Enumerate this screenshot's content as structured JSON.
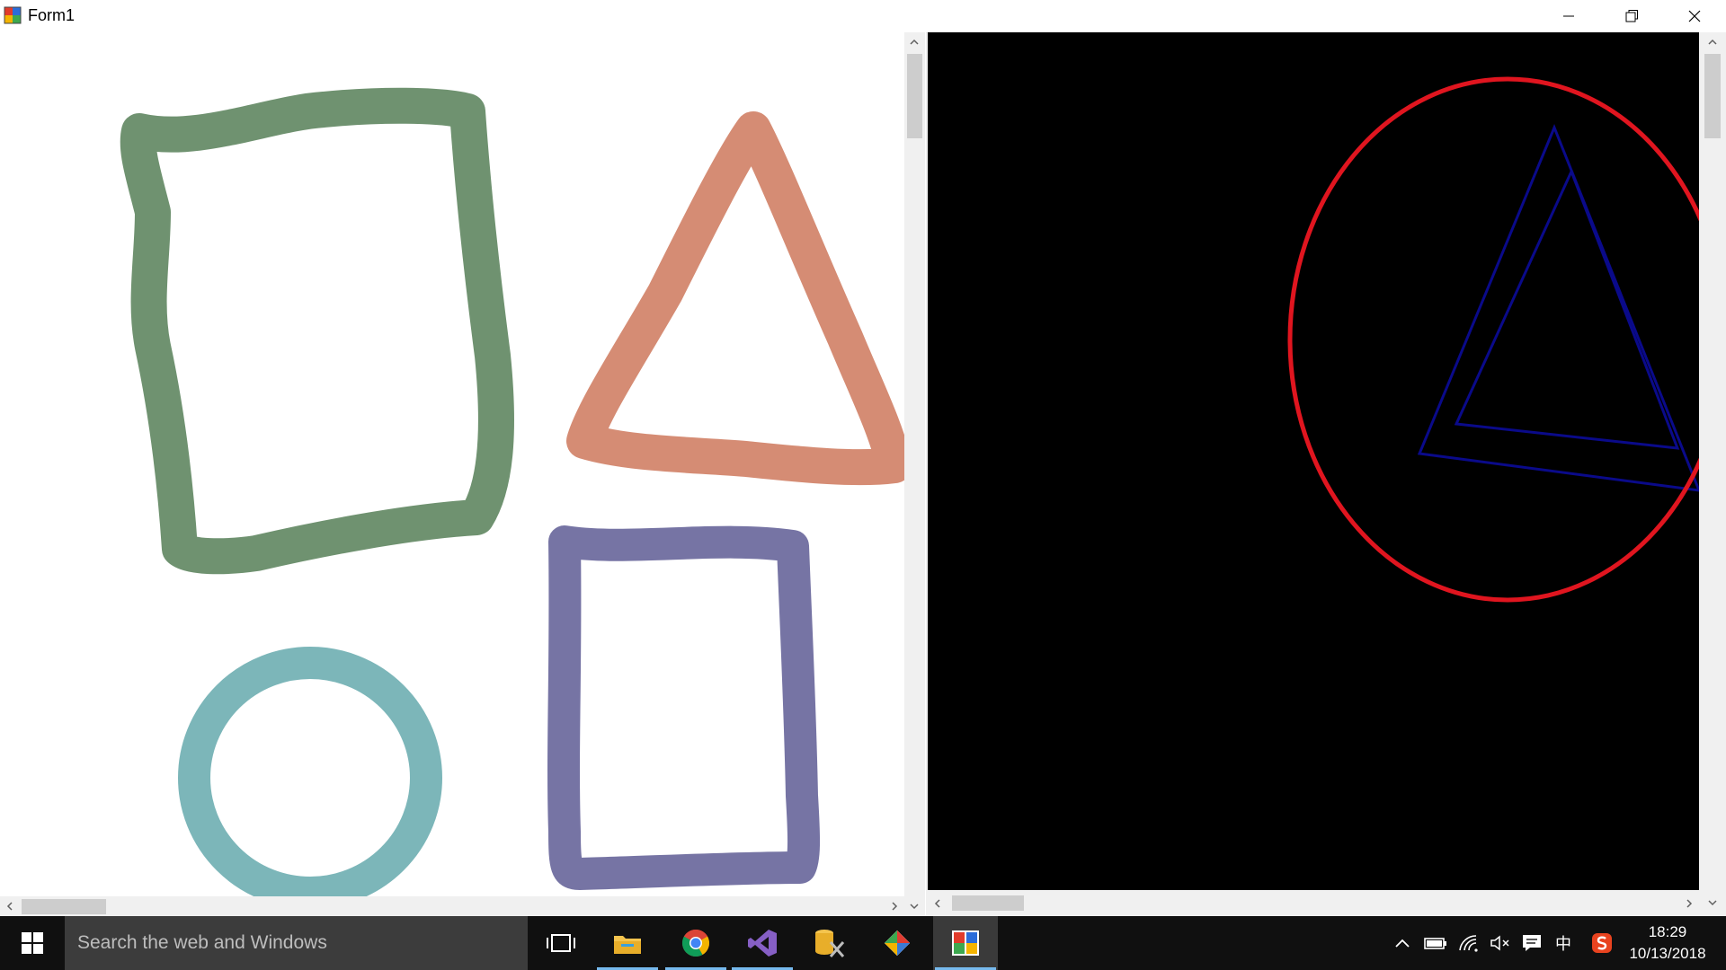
{
  "window": {
    "title": "Form1",
    "controls": {
      "minimize_icon": "minimize-icon",
      "restore_icon": "restore-icon",
      "close_icon": "close-icon"
    }
  },
  "left_canvas": {
    "background": "#ffffff",
    "shapes": [
      {
        "kind": "hand-drawn rectangle",
        "color": "#6f9270"
      },
      {
        "kind": "hand-drawn triangle",
        "color": "#d58c74"
      },
      {
        "kind": "hand-drawn circle",
        "color": "#7cb6b9"
      },
      {
        "kind": "hand-drawn rectangle",
        "color": "#7674a4"
      }
    ]
  },
  "right_canvas": {
    "background": "#000000",
    "shapes": [
      {
        "kind": "triangle outline",
        "color": "#0a0a8a"
      },
      {
        "kind": "triangle outline",
        "color": "#0a0a8a"
      },
      {
        "kind": "ellipse highlight",
        "color": "#e0151f"
      }
    ]
  },
  "taskbar": {
    "search_placeholder": "Search the web and Windows",
    "pinned": [
      "task-view-icon",
      "file-explorer-icon",
      "chrome-icon",
      "visual-studio-icon",
      "database-tools-icon",
      "git-icon",
      "form-app-icon"
    ],
    "tray_input_language": "中",
    "clock_time": "18:29",
    "clock_date": "10/13/2018"
  }
}
